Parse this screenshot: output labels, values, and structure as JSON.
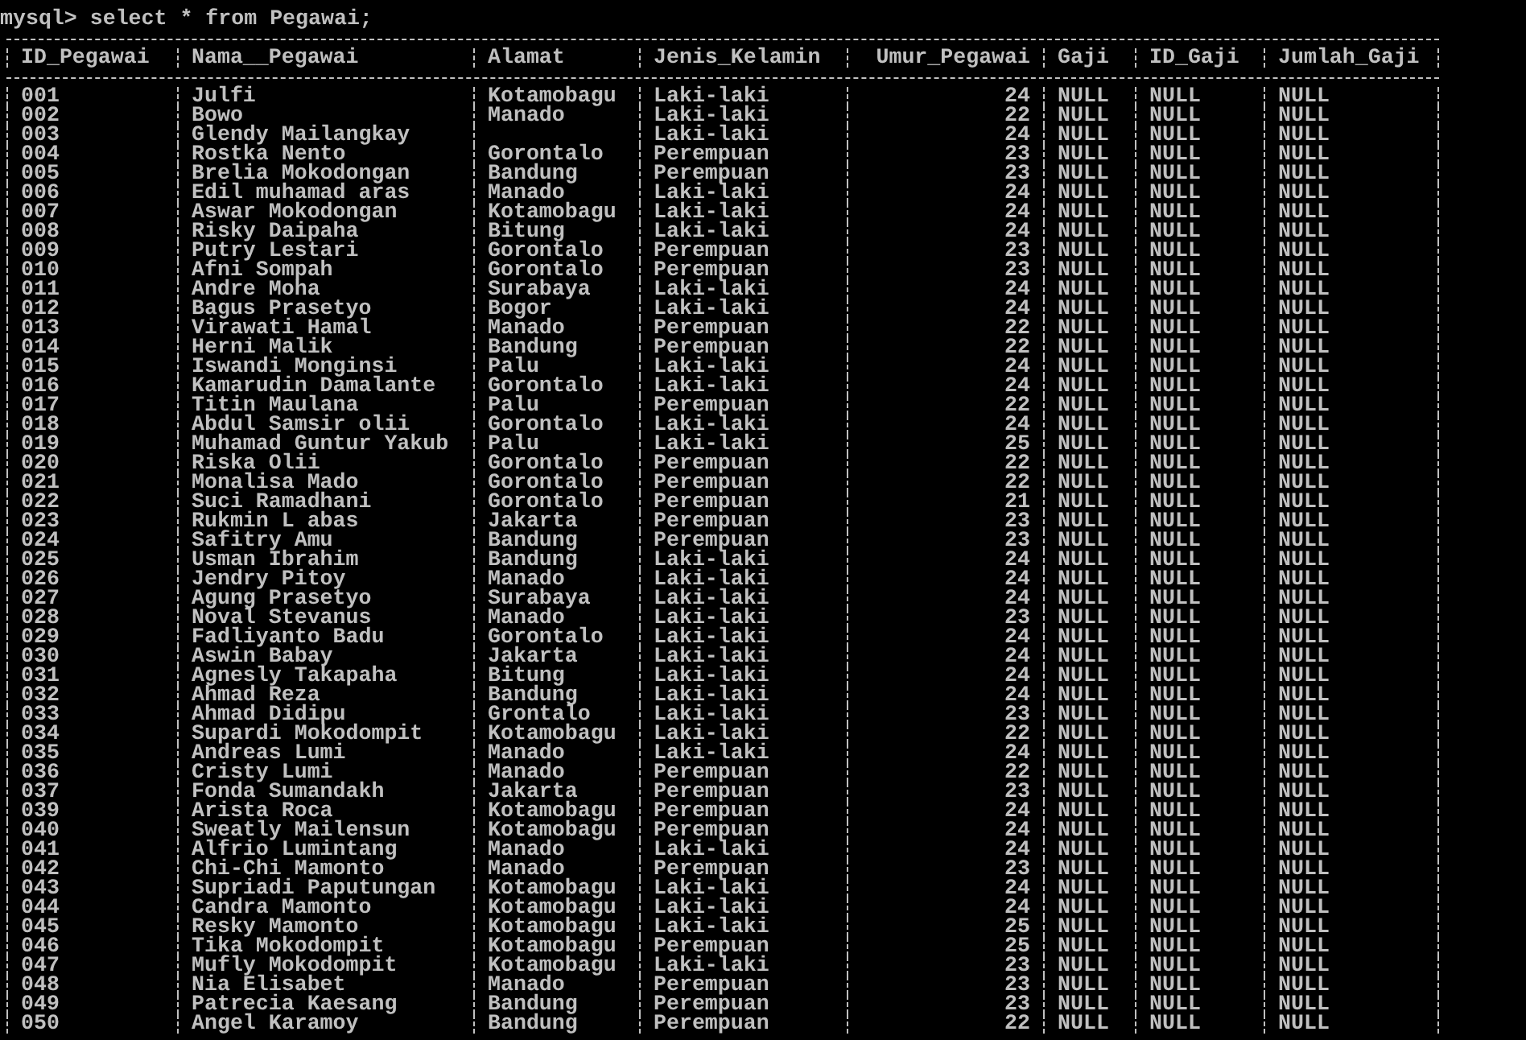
{
  "prompt": "mysql> select * from Pegawai;",
  "table": {
    "columns": [
      "ID_Pegawai",
      "Nama__Pegawai",
      "Alamat",
      "Jenis_Kelamin",
      "Umur_Pegawai",
      "Gaji",
      "ID_Gaji",
      "Jumlah_Gaji"
    ],
    "rows": [
      [
        "001",
        "Julfi",
        "Kotamobagu",
        "Laki-laki",
        "24",
        "NULL",
        "NULL",
        "NULL"
      ],
      [
        "002",
        "Bowo",
        "Manado",
        "Laki-laki",
        "22",
        "NULL",
        "NULL",
        "NULL"
      ],
      [
        "003",
        "Glendy Mailangkay",
        null,
        "Laki-laki",
        "24",
        "NULL",
        "NULL",
        "NULL"
      ],
      [
        "004",
        "Rostka Nento",
        "Gorontalo",
        "Perempuan",
        "23",
        "NULL",
        "NULL",
        "NULL"
      ],
      [
        "005",
        "Brelia Mokodongan",
        "Bandung",
        "Perempuan",
        "23",
        "NULL",
        "NULL",
        "NULL"
      ],
      [
        "006",
        "Edil muhamad aras",
        "Manado",
        "Laki-laki",
        "24",
        "NULL",
        "NULL",
        "NULL"
      ],
      [
        "007",
        "Aswar Mokodongan",
        "Kotamobagu",
        "Laki-laki",
        "24",
        "NULL",
        "NULL",
        "NULL"
      ],
      [
        "008",
        "Risky Daipaha",
        "Bitung",
        "Laki-laki",
        "24",
        "NULL",
        "NULL",
        "NULL"
      ],
      [
        "009",
        "Putry Lestari",
        "Gorontalo",
        "Perempuan",
        "23",
        "NULL",
        "NULL",
        "NULL"
      ],
      [
        "010",
        "Afni Sompah",
        "Gorontalo",
        "Perempuan",
        "23",
        "NULL",
        "NULL",
        "NULL"
      ],
      [
        "011",
        "Andre Moha",
        "Surabaya",
        "Laki-laki",
        "24",
        "NULL",
        "NULL",
        "NULL"
      ],
      [
        "012",
        "Bagus Prasetyo",
        "Bogor",
        "Laki-laki",
        "24",
        "NULL",
        "NULL",
        "NULL"
      ],
      [
        "013",
        "Virawati Hamal",
        "Manado",
        "Perempuan",
        "22",
        "NULL",
        "NULL",
        "NULL"
      ],
      [
        "014",
        "Herni Malik",
        "Bandung",
        "Perempuan",
        "22",
        "NULL",
        "NULL",
        "NULL"
      ],
      [
        "015",
        "Iswandi Monginsi",
        "Palu",
        "Laki-laki",
        "24",
        "NULL",
        "NULL",
        "NULL"
      ],
      [
        "016",
        "Kamarudin Damalante",
        "Gorontalo",
        "Laki-laki",
        "24",
        "NULL",
        "NULL",
        "NULL"
      ],
      [
        "017",
        "Titin Maulana",
        "Palu",
        "Perempuan",
        "22",
        "NULL",
        "NULL",
        "NULL"
      ],
      [
        "018",
        "Abdul Samsir olii",
        "Gorontalo",
        "Laki-laki",
        "24",
        "NULL",
        "NULL",
        "NULL"
      ],
      [
        "019",
        "Muhamad Guntur Yakub",
        "Palu",
        "Laki-laki",
        "25",
        "NULL",
        "NULL",
        "NULL"
      ],
      [
        "020",
        "Riska Olii",
        "Gorontalo",
        "Perempuan",
        "22",
        "NULL",
        "NULL",
        "NULL"
      ],
      [
        "021",
        "Monalisa Mado",
        "Gorontalo",
        "Perempuan",
        "22",
        "NULL",
        "NULL",
        "NULL"
      ],
      [
        "022",
        "Suci Ramadhani",
        "Gorontalo",
        "Perempuan",
        "21",
        "NULL",
        "NULL",
        "NULL"
      ],
      [
        "023",
        "Rukmin L abas",
        "Jakarta",
        "Perempuan",
        "23",
        "NULL",
        "NULL",
        "NULL"
      ],
      [
        "024",
        "Safitry Amu",
        "Bandung",
        "Perempuan",
        "23",
        "NULL",
        "NULL",
        "NULL"
      ],
      [
        "025",
        "Usman Ibrahim",
        "Bandung",
        "Laki-laki",
        "24",
        "NULL",
        "NULL",
        "NULL"
      ],
      [
        "026",
        "Jendry Pitoy",
        "Manado",
        "Laki-laki",
        "24",
        "NULL",
        "NULL",
        "NULL"
      ],
      [
        "027",
        "Agung Prasetyo",
        "Surabaya",
        "Laki-laki",
        "24",
        "NULL",
        "NULL",
        "NULL"
      ],
      [
        "028",
        "Noval Stevanus",
        "Manado",
        "Laki-laki",
        "23",
        "NULL",
        "NULL",
        "NULL"
      ],
      [
        "029",
        "Fadliyanto Badu",
        "Gorontalo",
        "Laki-laki",
        "24",
        "NULL",
        "NULL",
        "NULL"
      ],
      [
        "030",
        "Aswin Babay",
        "Jakarta",
        "Laki-laki",
        "24",
        "NULL",
        "NULL",
        "NULL"
      ],
      [
        "031",
        "Agnesly Takapaha",
        "Bitung",
        "Laki-laki",
        "24",
        "NULL",
        "NULL",
        "NULL"
      ],
      [
        "032",
        "Ahmad Reza",
        "Bandung",
        "Laki-laki",
        "24",
        "NULL",
        "NULL",
        "NULL"
      ],
      [
        "033",
        "Ahmad Didipu",
        "Grontalo",
        "Laki-laki",
        "23",
        "NULL",
        "NULL",
        "NULL"
      ],
      [
        "034",
        "Supardi Mokodompit",
        "Kotamobagu",
        "Laki-laki",
        "22",
        "NULL",
        "NULL",
        "NULL"
      ],
      [
        "035",
        "Andreas Lumi",
        "Manado",
        "Laki-laki",
        "24",
        "NULL",
        "NULL",
        "NULL"
      ],
      [
        "036",
        "Cristy Lumi",
        "Manado",
        "Perempuan",
        "22",
        "NULL",
        "NULL",
        "NULL"
      ],
      [
        "037",
        "Fonda Sumandakh",
        "Jakarta",
        "Perempuan",
        "23",
        "NULL",
        "NULL",
        "NULL"
      ],
      [
        "039",
        "Arista Roca",
        "Kotamobagu",
        "Perempuan",
        "24",
        "NULL",
        "NULL",
        "NULL"
      ],
      [
        "040",
        "Sweatly Mailensun",
        "Kotamobagu",
        "Perempuan",
        "24",
        "NULL",
        "NULL",
        "NULL"
      ],
      [
        "041",
        "Alfrio Lumintang",
        "Manado",
        "Laki-laki",
        "24",
        "NULL",
        "NULL",
        "NULL"
      ],
      [
        "042",
        "Chi-Chi Mamonto",
        "Manado",
        "Perempuan",
        "23",
        "NULL",
        "NULL",
        "NULL"
      ],
      [
        "043",
        "Supriadi Paputungan",
        "Kotamobagu",
        "Laki-laki",
        "24",
        "NULL",
        "NULL",
        "NULL"
      ],
      [
        "044",
        "Candra Mamonto",
        "Kotamobagu",
        "Laki-laki",
        "24",
        "NULL",
        "NULL",
        "NULL"
      ],
      [
        "045",
        "Resky Mamonto",
        "Kotamobagu",
        "Laki-laki",
        "25",
        "NULL",
        "NULL",
        "NULL"
      ],
      [
        "046",
        "Tika Mokodompit",
        "Kotamobagu",
        "Perempuan",
        "25",
        "NULL",
        "NULL",
        "NULL"
      ],
      [
        "047",
        "Mufly Mokodompit",
        "Kotamobagu",
        "Laki-laki",
        "23",
        "NULL",
        "NULL",
        "NULL"
      ],
      [
        "048",
        "Nia Elisabet",
        "Manado",
        "Perempuan",
        "23",
        "NULL",
        "NULL",
        "NULL"
      ],
      [
        "049",
        "Patrecia Kaesang",
        "Bandung",
        "Perempuan",
        "23",
        "NULL",
        "NULL",
        "NULL"
      ],
      [
        "050",
        "Angel Karamoy",
        "Bandung",
        "Perempuan",
        "22",
        "NULL",
        "NULL",
        "NULL"
      ]
    ]
  }
}
